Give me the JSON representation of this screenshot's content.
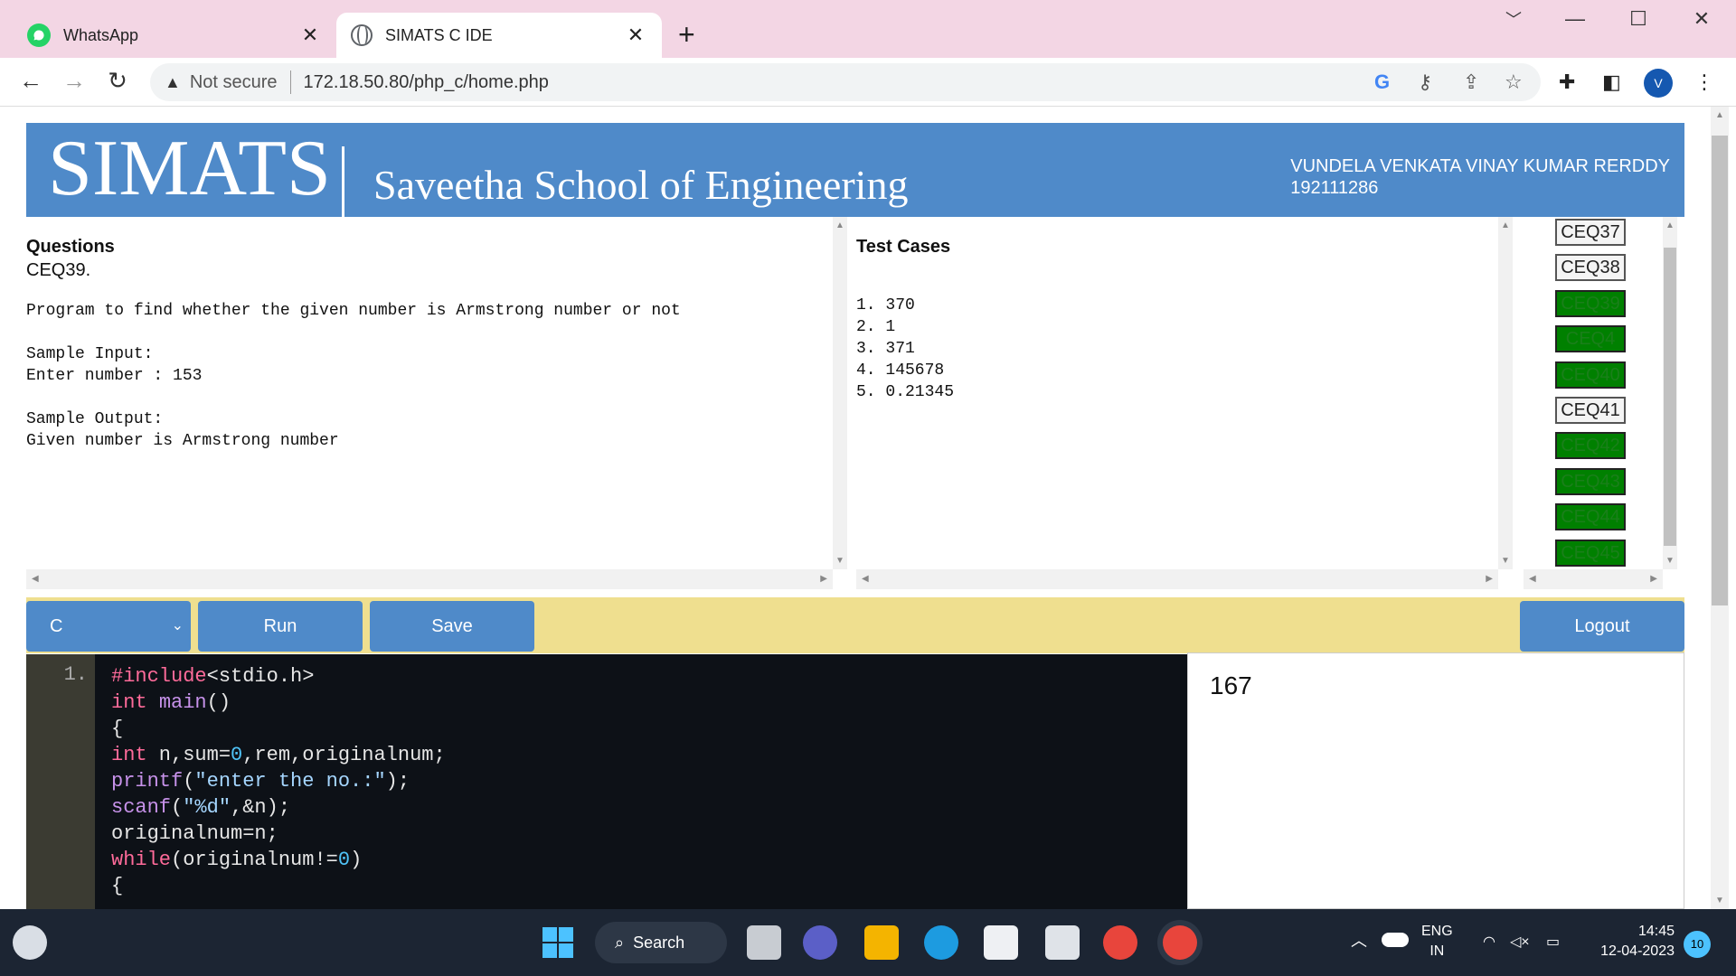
{
  "browser": {
    "tabs": [
      {
        "label": "WhatsApp"
      },
      {
        "label": "SIMATS C IDE"
      }
    ],
    "url_prefix": "Not secure",
    "url": "172.18.50.80/php_c/home.php",
    "avatar_letter": "V"
  },
  "header": {
    "logo": "SIMATS",
    "school": "Saveetha School of Engineering",
    "user_name": "VUNDELA VENKATA VINAY KUMAR RERDDY",
    "user_id": "192111286"
  },
  "questions": {
    "heading": "Questions",
    "id": "CEQ39.",
    "text": "Program to find whether the given number is Armstrong number or not\n\nSample Input:\nEnter number : 153\n\nSample Output:\nGiven number is Armstrong number"
  },
  "testcases": {
    "heading": "Test Cases",
    "text": "1. 370\n2. 1\n3. 371\n4. 145678\n5. 0.21345"
  },
  "question_list": [
    {
      "label": "CEQ37",
      "done": false
    },
    {
      "label": "CEQ38",
      "done": false
    },
    {
      "label": "CEQ39",
      "done": true
    },
    {
      "label": "CEQ4",
      "done": true
    },
    {
      "label": "CEQ40",
      "done": true
    },
    {
      "label": "CEQ41",
      "done": false
    },
    {
      "label": "CEQ42",
      "done": true
    },
    {
      "label": "CEQ43",
      "done": true
    },
    {
      "label": "CEQ44",
      "done": true
    },
    {
      "label": "CEQ45",
      "done": true
    }
  ],
  "controls": {
    "language": "C",
    "run": "Run",
    "save": "Save",
    "logout": "Logout"
  },
  "editor": {
    "line_numbers": "1.",
    "code_lines": [
      "#include<stdio.h>",
      "int main()",
      "{",
      "int n,sum=0,rem,originalnum;",
      "printf(\"enter the no.:\");",
      "scanf(\"%d\",&n);",
      "originalnum=n;",
      "while(originalnum!=0)",
      "{"
    ]
  },
  "output": "167",
  "taskbar": {
    "search": "Search",
    "lang_line1": "ENG",
    "lang_line2": "IN",
    "time": "14:45",
    "date": "12-04-2023",
    "notifications": "10"
  }
}
